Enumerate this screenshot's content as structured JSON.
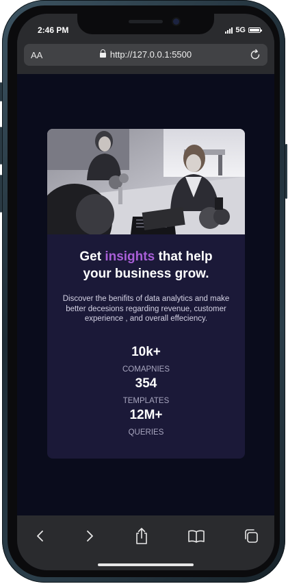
{
  "status_bar": {
    "time": "2:46 PM",
    "network": "5G"
  },
  "browser": {
    "text_size_label": "AA",
    "url": "http://127.0.0.1:5500"
  },
  "card": {
    "title_prefix": "Get ",
    "title_accent": "insights",
    "title_line1_suffix": " that help",
    "title_line2": "your business grow.",
    "description": "Discover the benifits of data analytics and make better decesions regarding revenue, customer experience , and overall effeciency.",
    "stats": [
      {
        "value": "10k+",
        "label": "COMAPNIES"
      },
      {
        "value": "354",
        "label": "TEMPLATES"
      },
      {
        "value": "12M+",
        "label": "QUERIES"
      }
    ]
  },
  "colors": {
    "page_background": "#0a0c1c",
    "card_background": "#1b1938",
    "accent": "#a95fd8",
    "browser_chrome": "#2a2b2e"
  },
  "icons": {
    "lock": "lock-icon",
    "reload": "reload-icon",
    "back": "chevron-left-icon",
    "forward": "chevron-right-icon",
    "share": "share-icon",
    "bookmarks": "book-icon",
    "tabs": "tabs-icon"
  }
}
